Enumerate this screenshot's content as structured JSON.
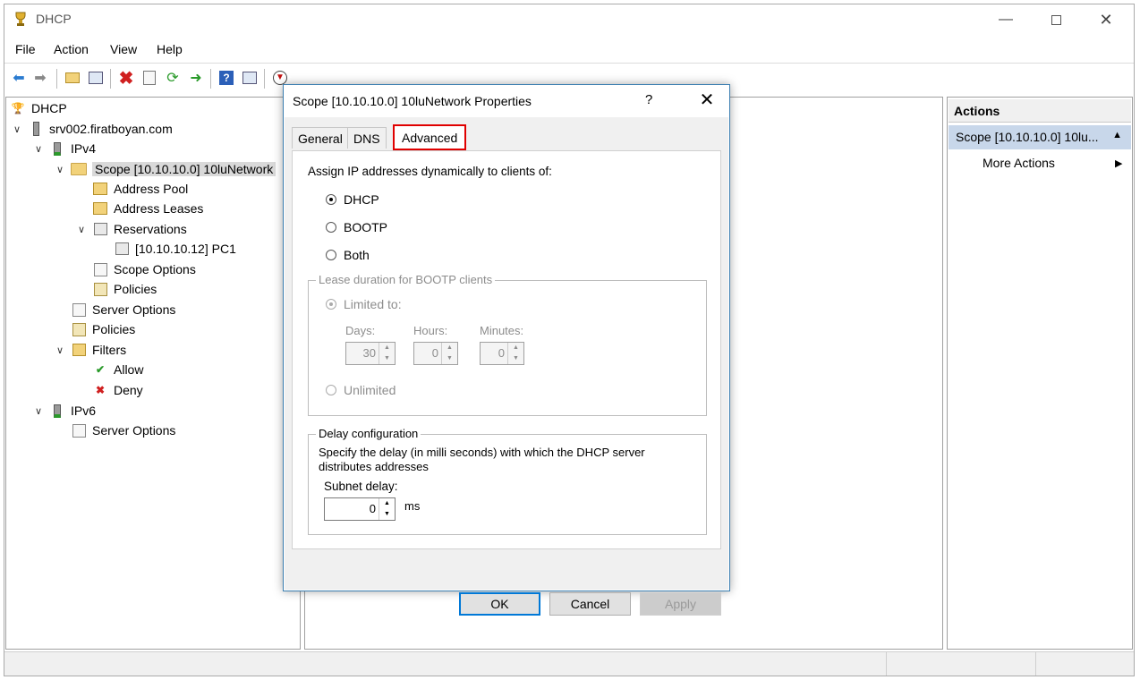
{
  "window": {
    "title": "DHCP"
  },
  "menu": [
    "File",
    "Action",
    "View",
    "Help"
  ],
  "tree": {
    "root": "DHCP",
    "server": "srv002.firatboyan.com",
    "ipv4": "IPv4",
    "scope": "Scope [10.10.10.0] 10luNetwork",
    "address_pool": "Address Pool",
    "address_leases": "Address Leases",
    "reservations": "Reservations",
    "reservation_pc1": "[10.10.10.12] PC1",
    "scope_options": "Scope Options",
    "policies_scope": "Policies",
    "server_options": "Server Options",
    "policies": "Policies",
    "filters": "Filters",
    "allow": "Allow",
    "deny": "Deny",
    "ipv6": "IPv6",
    "ipv6_server_options": "Server Options"
  },
  "actions": {
    "header": "Actions",
    "scope_item": "Scope [10.10.10.0] 10lu...",
    "more": "More Actions"
  },
  "dialog": {
    "title": "Scope [10.10.10.0] 10luNetwork Properties",
    "help": "?",
    "tabs": [
      "General",
      "DNS",
      "Advanced"
    ],
    "active_tab": "Advanced",
    "assign_label": "Assign IP addresses dynamically to clients of:",
    "radio_dhcp": "DHCP",
    "radio_bootp": "BOOTP",
    "radio_both": "Both",
    "selected_radio": "DHCP",
    "lease_group": "Lease duration for BOOTP clients",
    "limited_to": "Limited to:",
    "days_label": "Days:",
    "hours_label": "Hours:",
    "minutes_label": "Minutes:",
    "days": "30",
    "hours": "0",
    "minutes": "0",
    "unlimited": "Unlimited",
    "delay_group": "Delay configuration",
    "delay_desc": "Specify the delay (in milli seconds) with which the DHCP server distributes addresses",
    "subnet_delay_label": "Subnet delay:",
    "subnet_delay": "0",
    "ms": "ms",
    "ok": "OK",
    "cancel": "Cancel",
    "apply": "Apply"
  },
  "colors": {
    "tab_highlight": "#e00000",
    "default_button": "#0078d7",
    "selected_action": "#c8d7ea"
  }
}
